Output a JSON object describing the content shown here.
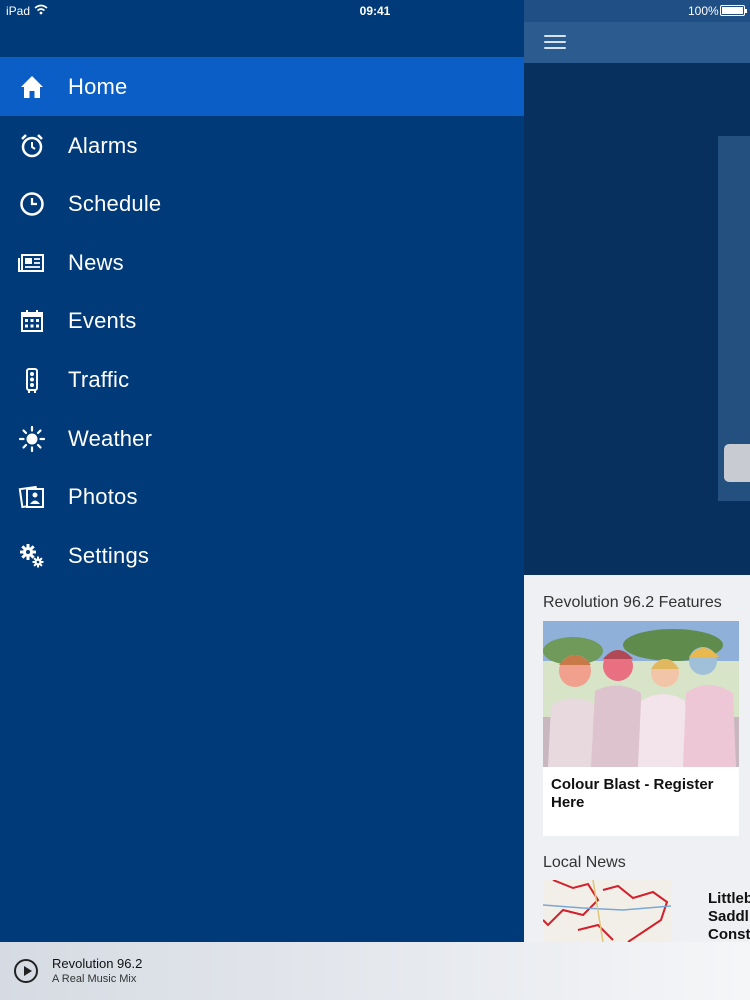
{
  "status_bar": {
    "device": "iPad",
    "time": "09:41",
    "battery": "100%"
  },
  "menu": {
    "items": [
      {
        "label": "Home",
        "icon": "home-icon",
        "active": true
      },
      {
        "label": "Alarms",
        "icon": "alarm-clock-icon"
      },
      {
        "label": "Schedule",
        "icon": "clock-icon"
      },
      {
        "label": "News",
        "icon": "newspaper-icon"
      },
      {
        "label": "Events",
        "icon": "calendar-icon"
      },
      {
        "label": "Traffic",
        "icon": "traffic-light-icon"
      },
      {
        "label": "Weather",
        "icon": "sun-icon"
      },
      {
        "label": "Photos",
        "icon": "photos-icon"
      },
      {
        "label": "Settings",
        "icon": "gears-icon"
      }
    ]
  },
  "main": {
    "features_title": "Revolution 96.2 Features",
    "feature_caption": "Colour Blast - Register Here",
    "local_news_title": "Local News",
    "news_headline_lines": [
      "Littleb",
      "Saddl",
      "Const"
    ]
  },
  "player": {
    "station": "Revolution 96.2",
    "tagline": "A Real Music Mix"
  },
  "colors": {
    "drawer": "#003a78",
    "active_item": "#0a5ec5",
    "hero": "#07305f"
  }
}
